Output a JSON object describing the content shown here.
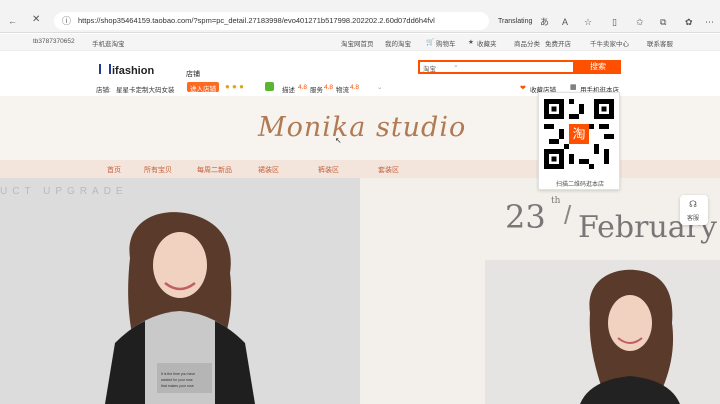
{
  "browser": {
    "url": "https://shop35464159.taobao.com/?spm=pc_detail.27183998/evo401271b517998.202202.2.60d07dd6h4fvl",
    "translate_label": "Translating"
  },
  "topbar": {
    "user_id": "tb3787370652",
    "mobile_link": "手机逛淘宝",
    "taobao_home": "淘宝网首页",
    "my_taobao": "我的淘宝",
    "cart": "购物车",
    "favorites": "收藏夹",
    "categories": "商品分类",
    "free_shop": "免费开店",
    "seller_center": "千牛卖家中心",
    "contact": "联系客服"
  },
  "shop": {
    "brand": "ifashion",
    "store_tag": "店铺",
    "store_label": "店铺:",
    "store_name": "星星卡定制大码女装",
    "enter_store": "进入店铺",
    "rating_desc_label": "描述",
    "rating_desc": "4.8",
    "rating_service_label": "服务",
    "rating_service": "4.8",
    "rating_logistics_label": "物流",
    "rating_logistics": "4.8",
    "favorite_store": "收藏店铺",
    "mobile_store": "用手机逛本店"
  },
  "search": {
    "scope": "淘宝",
    "button": "搜索"
  },
  "banner": {
    "title": "Monika studio"
  },
  "nav": {
    "items": [
      "首页",
      "所有宝贝",
      "每周二新品",
      "裙装区",
      "裤装区",
      "套装区"
    ]
  },
  "qr": {
    "caption": "扫描二维码逛本店"
  },
  "hero": {
    "left_text": "UCT  UPGRADE",
    "day": "23",
    "day_suffix": "th",
    "month": "February"
  },
  "side": {
    "service": "客服"
  },
  "colors": {
    "accent": "#ff5000",
    "nav_bg": "#f3e5dc",
    "nav_text": "#c4603a"
  }
}
